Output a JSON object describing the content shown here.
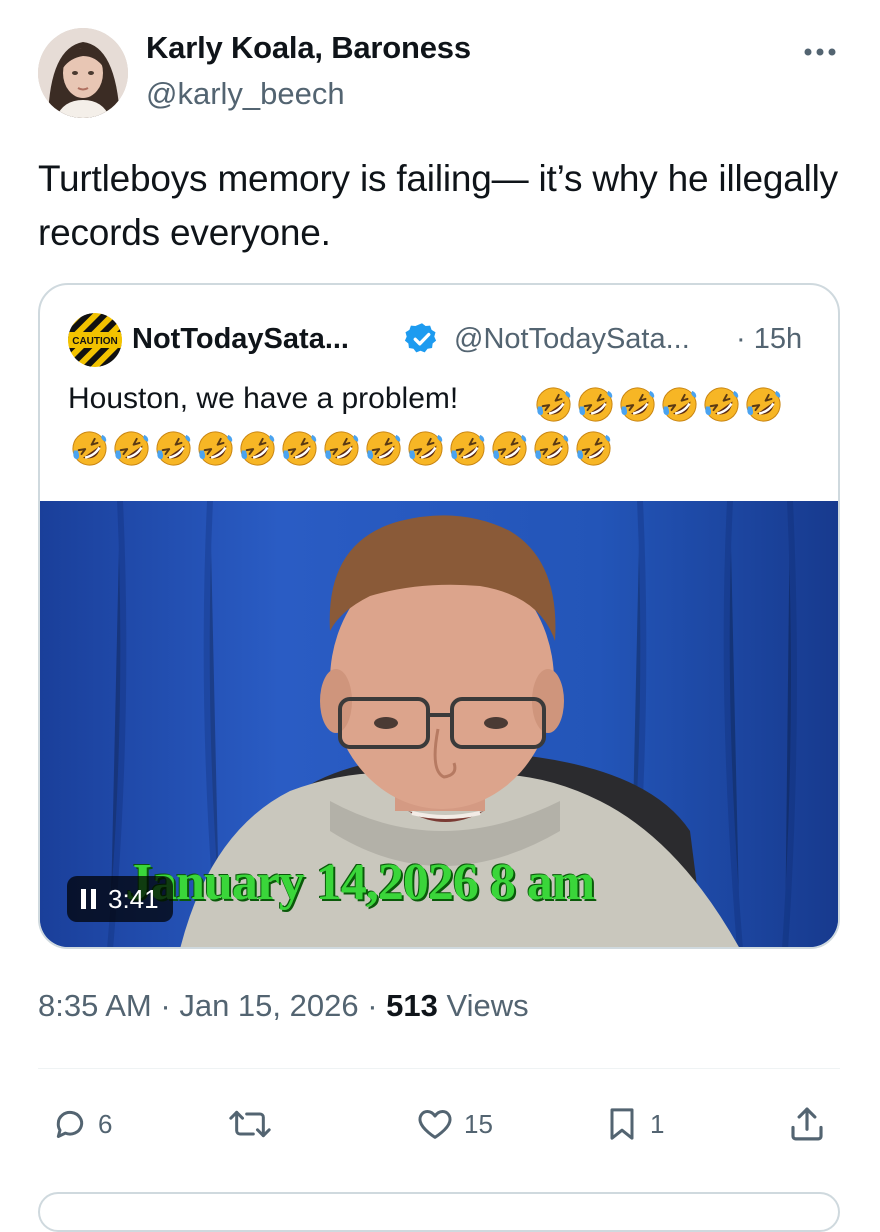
{
  "author": {
    "display_name": "Karly Koala, Baroness",
    "handle": "@karly_beech"
  },
  "tweet_text": "Turtleboys memory is failing— it’s why he illegally records everyone.",
  "quoted_tweet": {
    "author_name": "NotTodaySata...",
    "handle": "@NotTodaySata...",
    "time": "· 15h",
    "avatar_label": "CAUTION",
    "text": "Houston, we have a problem!",
    "emoji_name": "rolling-on-the-floor-laughing",
    "emoji_row1_count": 6,
    "emoji_row2_count": 13,
    "video": {
      "overlay_text": "January 14,2026  8 am",
      "duration": "3:41",
      "state": "playing"
    }
  },
  "meta": {
    "time": "8:35 AM",
    "separator": "·",
    "date": "Jan 15, 2026",
    "views_count": "513",
    "views_label": "Views"
  },
  "actions": {
    "replies": "6",
    "reposts": "",
    "likes": "15",
    "bookmarks": "1"
  },
  "colors": {
    "text": "#0f1419",
    "secondary": "#536471",
    "border": "#cfd9de",
    "verified": "#1d9bf0",
    "overlay_green": "#3ad63a",
    "backdrop_blue": "#1d47a8"
  },
  "icons": [
    "more-icon",
    "verified-badge-icon",
    "pause-icon",
    "reply-icon",
    "repost-icon",
    "like-icon",
    "bookmark-icon",
    "share-icon"
  ]
}
